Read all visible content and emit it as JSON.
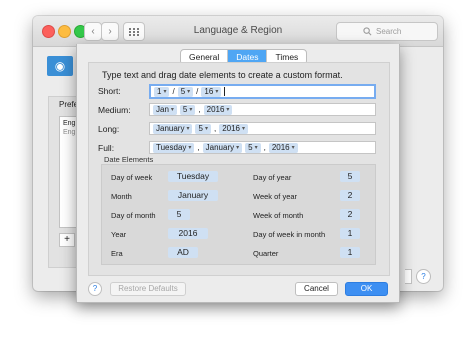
{
  "window": {
    "title": "Language & Region",
    "search_placeholder": "Search",
    "back_icon": "chevron-left-icon",
    "forward_icon": "chevron-right-icon",
    "grid_icon": "grid-icon",
    "preferred_label": "Prefe",
    "list_items": [
      "Eng",
      "Eng"
    ],
    "add_label": "+",
    "help_label": "?"
  },
  "sheet": {
    "tabs": [
      {
        "label": "General",
        "selected": false
      },
      {
        "label": "Dates",
        "selected": true
      },
      {
        "label": "Times",
        "selected": false
      }
    ],
    "instructions": "Type text and drag date elements to create a custom format.",
    "formats": {
      "short": {
        "label": "Short:",
        "parts": [
          "1",
          "/",
          "5",
          "/",
          "16"
        ]
      },
      "medium": {
        "label": "Medium:",
        "parts": [
          "Jan",
          "5",
          ",",
          "2016"
        ]
      },
      "long": {
        "label": "Long:",
        "parts": [
          "January",
          "5",
          ",",
          "2016"
        ]
      },
      "full": {
        "label": "Full:",
        "parts": [
          "Tuesday",
          ",",
          "January",
          "5",
          ",",
          "2016"
        ]
      }
    },
    "date_elements_title": "Date Elements",
    "elements_left": [
      {
        "label": "Day of week",
        "value": "Tuesday"
      },
      {
        "label": "Month",
        "value": "January"
      },
      {
        "label": "Day of month",
        "value": "5"
      },
      {
        "label": "Year",
        "value": "2016"
      },
      {
        "label": "Era",
        "value": "AD"
      }
    ],
    "elements_right": [
      {
        "label": "Day of year",
        "value": "5"
      },
      {
        "label": "Week of year",
        "value": "2"
      },
      {
        "label": "Week of month",
        "value": "2"
      },
      {
        "label": "Day of week in month",
        "value": "1"
      },
      {
        "label": "Quarter",
        "value": "1"
      }
    ],
    "help_label": "?",
    "restore_label": "Restore Defaults",
    "cancel_label": "Cancel",
    "ok_label": "OK"
  },
  "colors": {
    "accent": "#3d8ff2",
    "tab_selected": "#4fa6f4",
    "token_bg": "#cfe0f3",
    "focus_ring": "#77acf0"
  }
}
